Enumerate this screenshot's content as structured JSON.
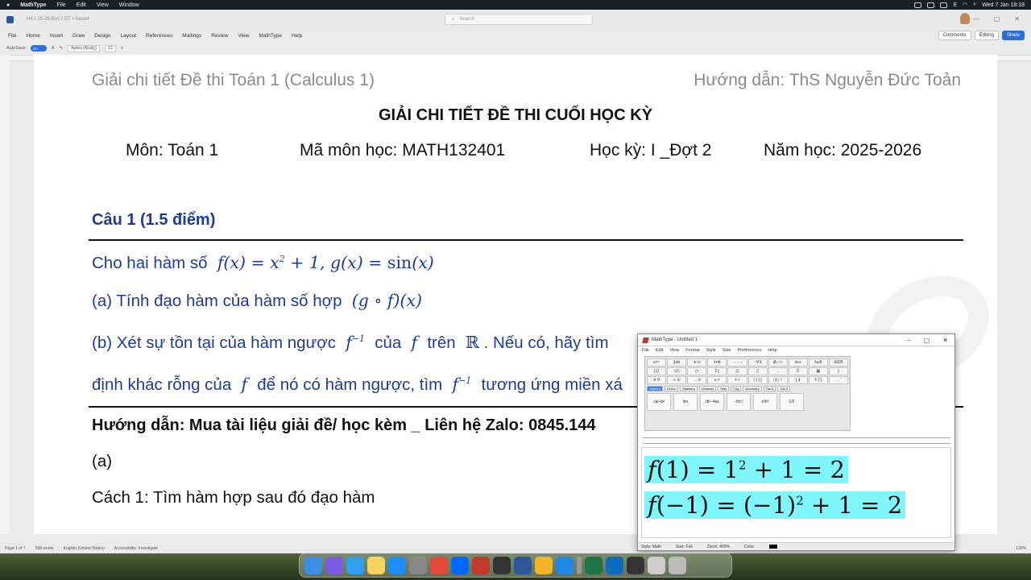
{
  "menubar": {
    "app": "MathType",
    "items": [
      "File",
      "Edit",
      "View",
      "Window"
    ],
    "clock": "Wed 7 Jan 18:18",
    "input": "E"
  },
  "word": {
    "doc_title": "HK I 25-26 Đợt 2 DT • Saved",
    "search_placeholder": "Search",
    "tabs": [
      "File",
      "Home",
      "Insert",
      "Draw",
      "Design",
      "Layout",
      "References",
      "Mailings",
      "Review",
      "View",
      "MathType",
      "Help"
    ],
    "comments": "Comments",
    "editing": "Editing",
    "share": "Share",
    "autosave": "AutoSave",
    "autosave_state": "On",
    "font": "Aptos (Body)",
    "size": "12"
  },
  "ruler_marks": [
    "1",
    "2",
    "3",
    "4",
    "5",
    "6",
    "7"
  ],
  "document": {
    "header_left": "Giải chi tiết Đề thi Toán 1 (Calculus 1)",
    "header_right": "Hướng dẫn: ThS Nguyễn Đức Toản",
    "title": "GIẢI CHI TIẾT ĐỀ THI CUỐI HỌC KỲ",
    "subject": "Môn: Toán 1",
    "code": "Mã môn học: MATH132401",
    "term": "Học kỳ: I _Đợt 2",
    "year": "Năm học: 2025-2026",
    "question_title": "Câu 1 (1.5 điểm)",
    "q_intro": "Cho hai hàm số",
    "q_a": "(a) Tính đạo hàm của hàm số hợp",
    "q_b1": "(b) Xét sự tồn tại của hàm ngược",
    "q_b2": "của",
    "q_b3": "trên",
    "q_b4": ". Nếu có, hãy tìm",
    "q_c1": "định khác rỗng của",
    "q_c2": "để nó có hàm ngược, tìm",
    "q_c3": "tương ứng miền xá",
    "guide": "Hướng dẫn:     Mua tài liệu giải đề/ học kèm _ Liên hệ Zalo: 0845.144",
    "part_a": "(a)",
    "method": "Cách 1: Tìm hàm hợp sau đó đạo hàm"
  },
  "status": {
    "page": "Page 1 of 7",
    "words": "598 words",
    "lang": "English (United States)",
    "access": "Accessibility: Investigate",
    "zoom": "130%"
  },
  "mathtype": {
    "title": "MathType - Untitled 1",
    "menu": [
      "File",
      "Edit",
      "View",
      "Format",
      "Style",
      "Size",
      "Preferences",
      "Help"
    ],
    "palette_tabs": [
      "Algebra",
      "Derivs",
      "Statistics",
      "Matrices",
      "Sets",
      "Trig",
      "Geometry",
      "Tab 8",
      "Tab 9"
    ],
    "status_style": "Style: Math",
    "status_size": "Size: Full",
    "status_zoom": "Zoom: 400%",
    "status_color": "Color:",
    "highlight": "#7ff6fb"
  }
}
